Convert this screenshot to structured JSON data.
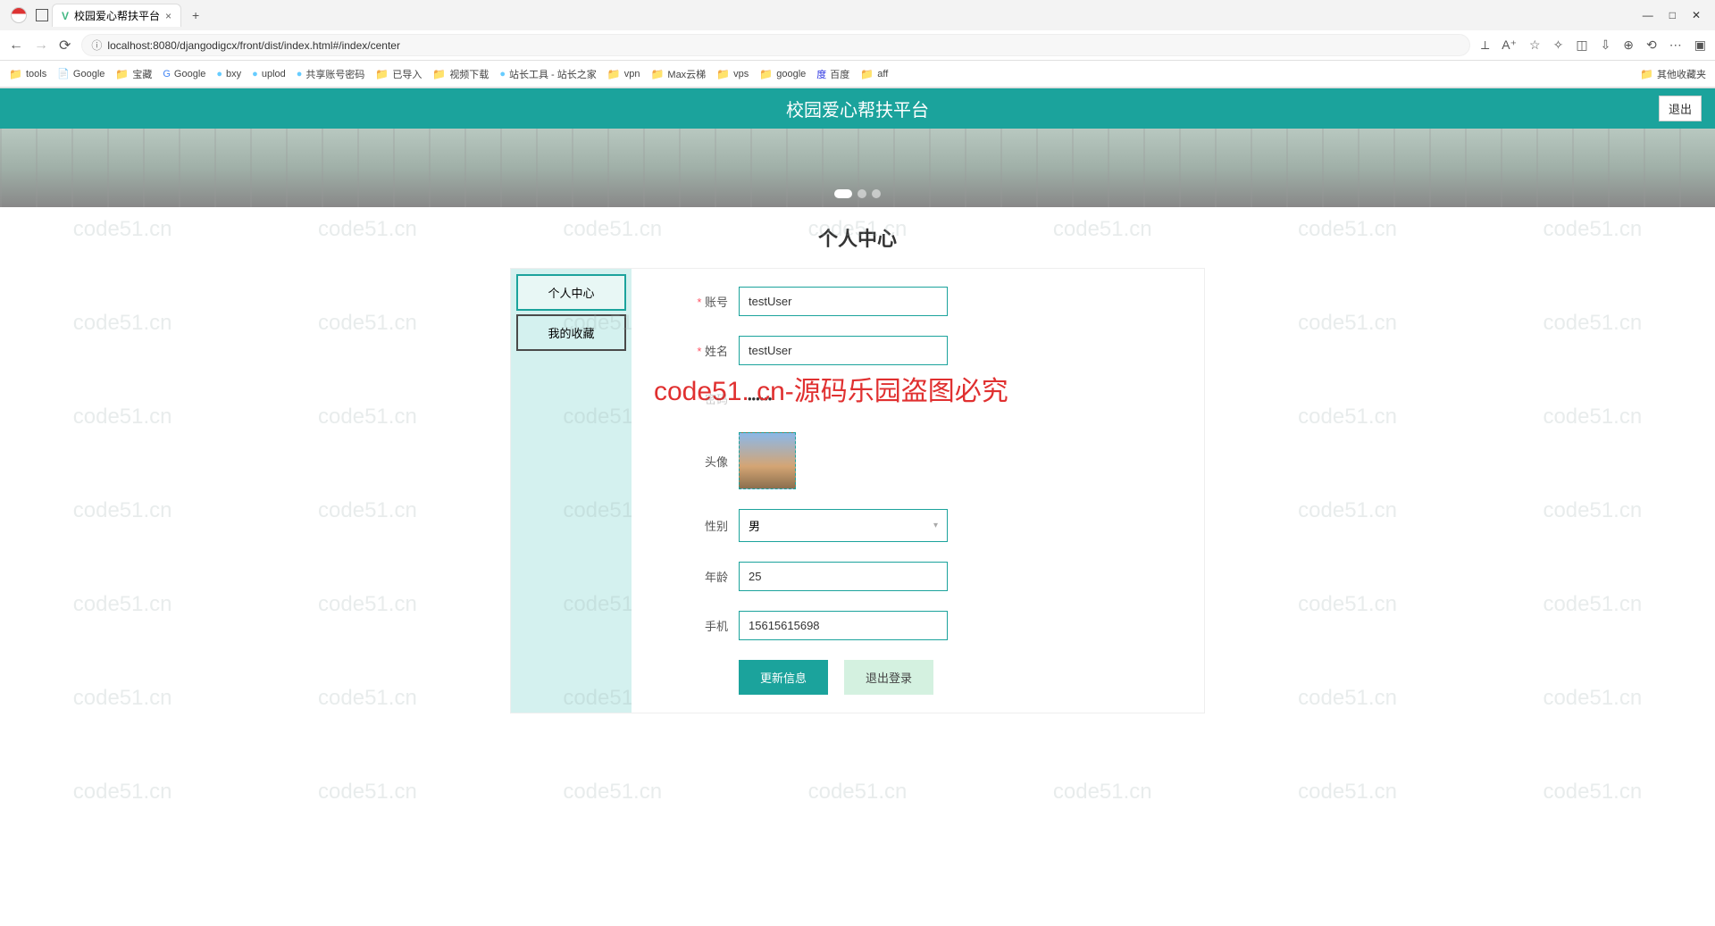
{
  "browser": {
    "tab_title": "校园爱心帮扶平台",
    "url": "localhost:8080/djangodigcx/front/dist/index.html#/index/center",
    "new_tab": "+",
    "close": "×"
  },
  "window": {
    "min": "—",
    "max": "□",
    "close": "✕"
  },
  "bookmarks": [
    {
      "icon": "folder",
      "label": "tools"
    },
    {
      "icon": "page",
      "label": "Google"
    },
    {
      "icon": "folder",
      "label": "宝藏"
    },
    {
      "icon": "g",
      "label": "Google"
    },
    {
      "icon": "bxy",
      "label": "bxy"
    },
    {
      "icon": "uplod",
      "label": "uplod"
    },
    {
      "icon": "1",
      "label": "共享账号密码"
    },
    {
      "icon": "folder",
      "label": "已导入"
    },
    {
      "icon": "folder",
      "label": "视频下载"
    },
    {
      "icon": "s",
      "label": "站长工具 - 站长之家"
    },
    {
      "icon": "folder",
      "label": "vpn"
    },
    {
      "icon": "folder",
      "label": "Max云梯"
    },
    {
      "icon": "folder",
      "label": "vps"
    },
    {
      "icon": "folder",
      "label": "google"
    },
    {
      "icon": "b",
      "label": "百度"
    },
    {
      "icon": "folder",
      "label": "aff"
    }
  ],
  "bookmark_other": "其他收藏夹",
  "header": {
    "title": "校园爱心帮扶平台",
    "logout": "退出"
  },
  "page": {
    "title": "个人中心"
  },
  "sidebar": {
    "items": [
      "个人中心",
      "我的收藏"
    ]
  },
  "form": {
    "account": {
      "label": "账号",
      "value": "testUser"
    },
    "name": {
      "label": "姓名",
      "value": "testUser"
    },
    "password": {
      "label": "密码",
      "value": "••••••"
    },
    "avatar": {
      "label": "头像"
    },
    "gender": {
      "label": "性别",
      "value": "男"
    },
    "age": {
      "label": "年龄",
      "value": "25"
    },
    "phone": {
      "label": "手机",
      "value": "15615615698"
    }
  },
  "buttons": {
    "update": "更新信息",
    "logout": "退出登录"
  },
  "watermark": "code51.cn",
  "overlay": "code51. cn-源码乐园盗图必究"
}
